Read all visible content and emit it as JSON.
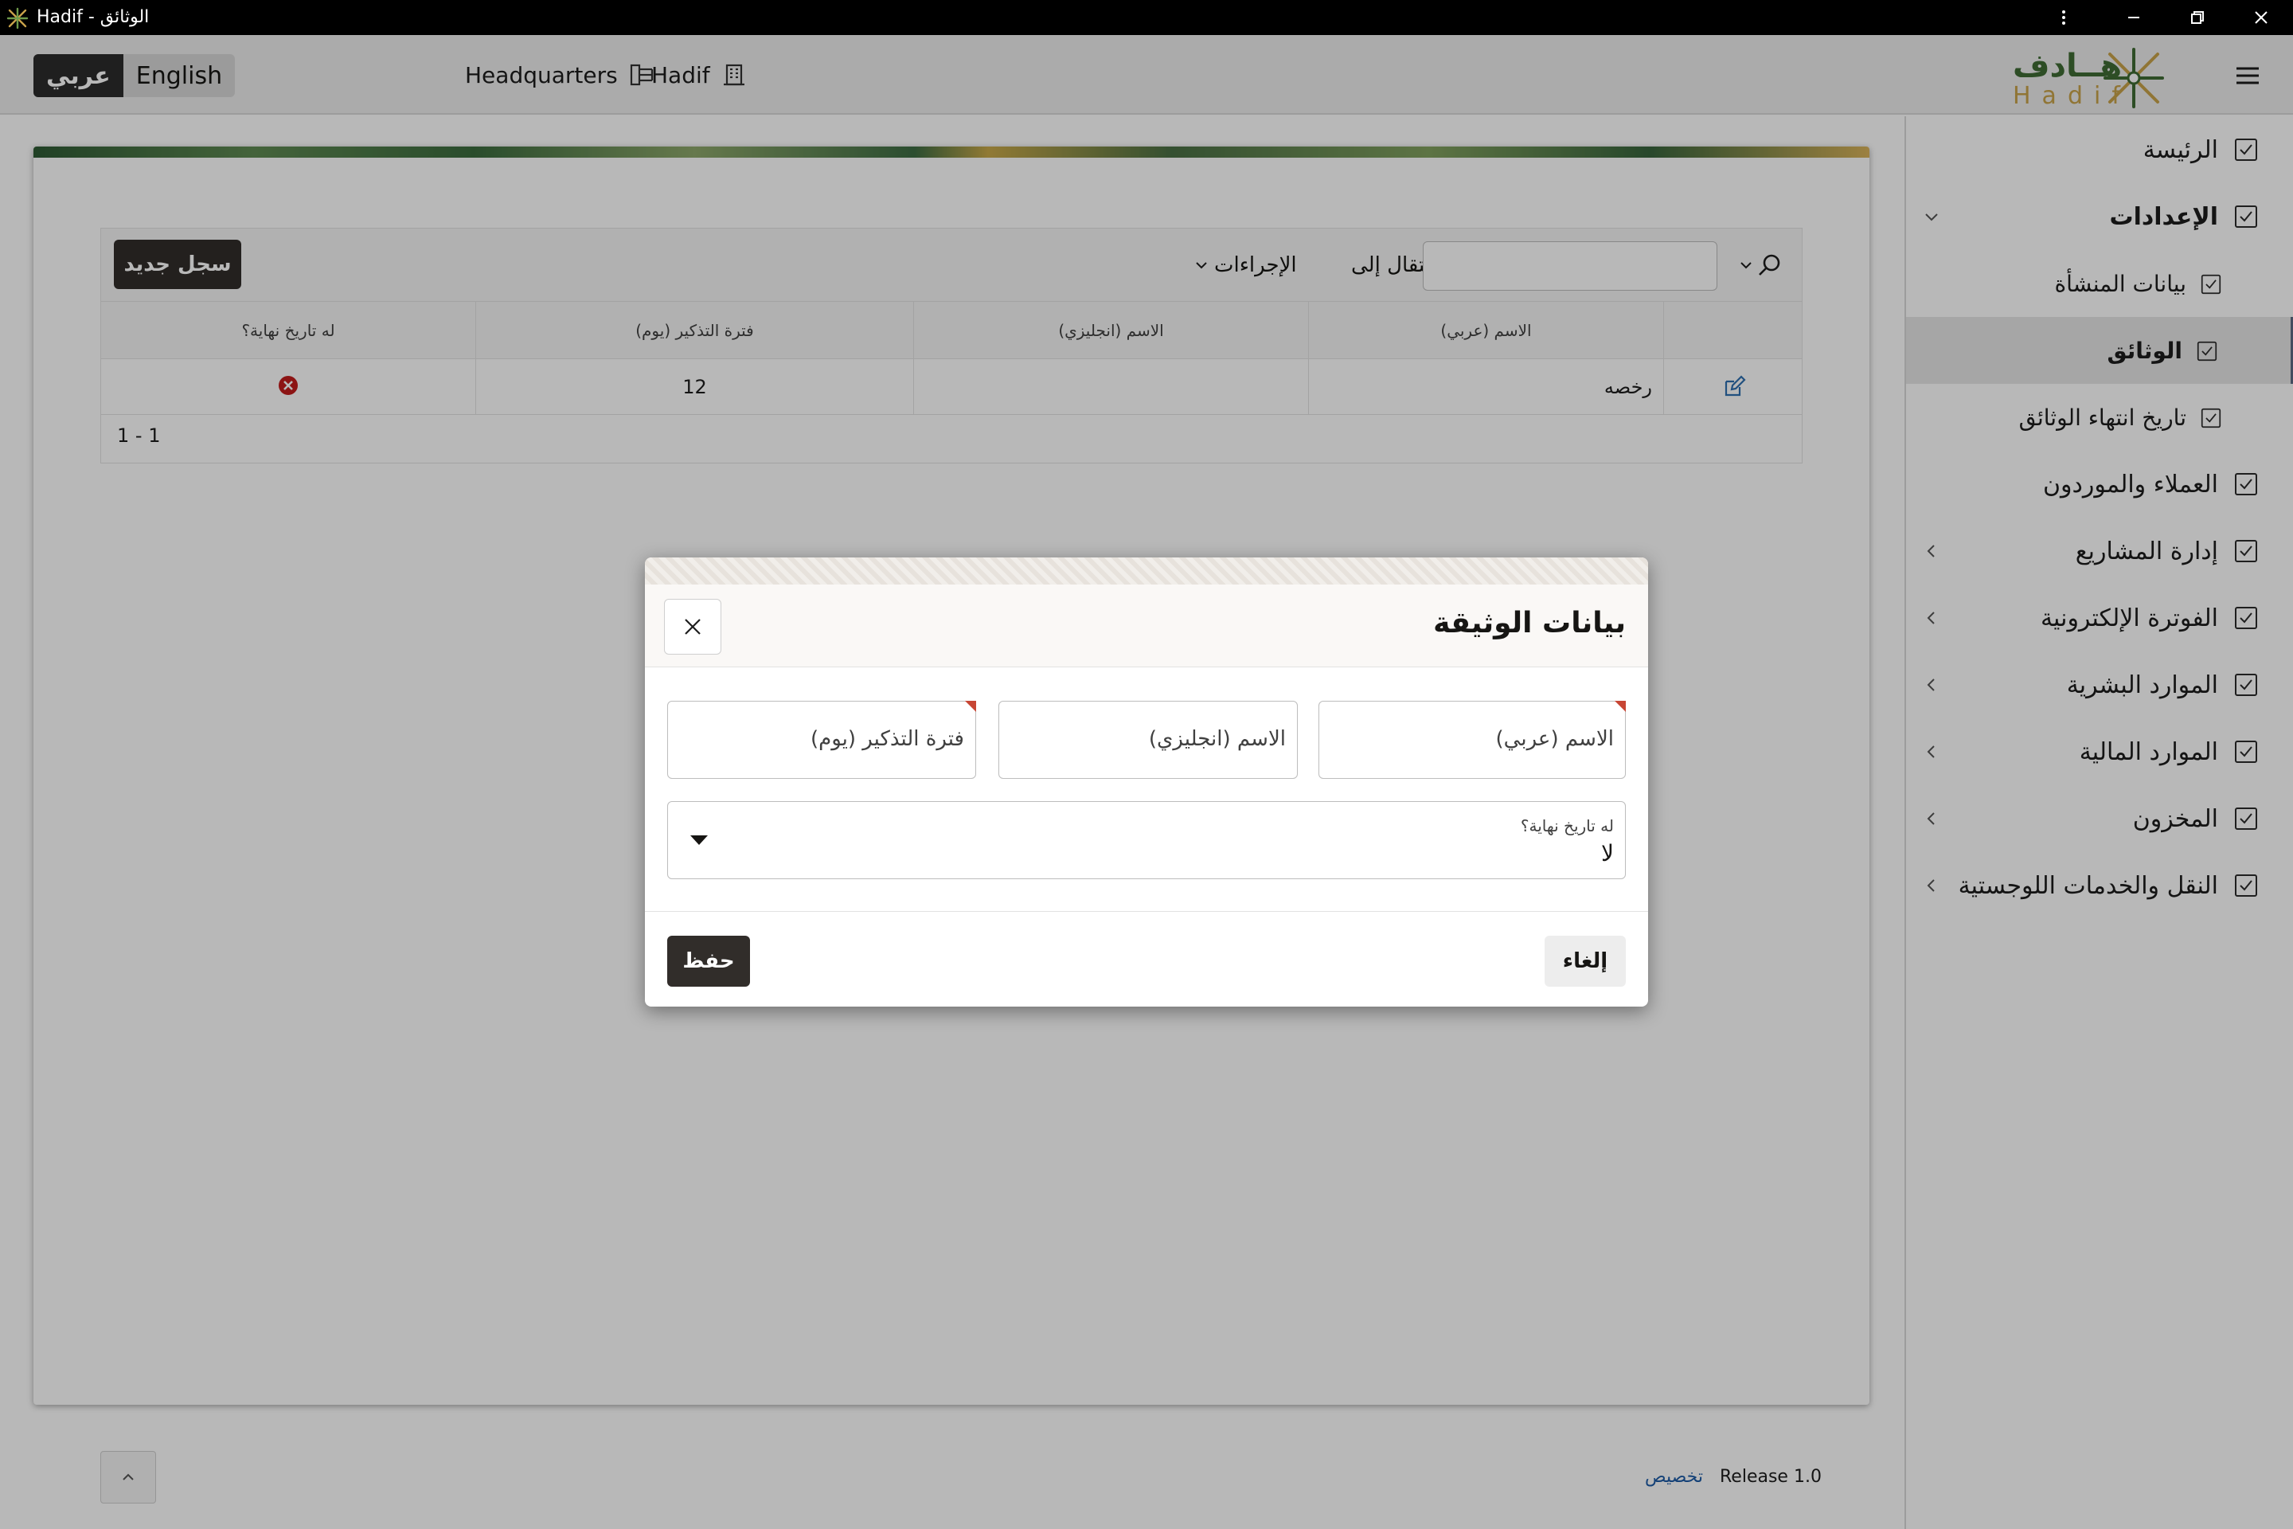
{
  "window": {
    "title": "Hadif - الوثائق",
    "icon": "hadif-logo-icon"
  },
  "header": {
    "lang_arabic": "عربي",
    "lang_english": "English",
    "org_unit": "Headquarters",
    "company": "Hadif",
    "logo_arabic": "هــادف",
    "logo_latin": "Hadif"
  },
  "toolbar": {
    "new_record": "سجل جديد",
    "actions": "الإجراءات",
    "go_to": "انتقال إلى",
    "search_placeholder": ""
  },
  "grid": {
    "columns": [
      "الاسم (عربي)",
      "الاسم (انجليزي)",
      "فترة التذكير (يوم)",
      "له تاريخ نهاية؟"
    ],
    "rows": [
      {
        "name_ar": "رخصه",
        "name_en": "",
        "reminder_days": "12",
        "has_end_date": "no"
      }
    ],
    "pagination": "1 - 1"
  },
  "sidebar": {
    "items": [
      {
        "label": "الرئيسة",
        "level": 0
      },
      {
        "label": "الإعدادات",
        "level": 0,
        "expanded": true
      },
      {
        "label": "بيانات المنشأة",
        "level": 1
      },
      {
        "label": "الوثائق",
        "level": 1,
        "active": true
      },
      {
        "label": "تاريخ انتهاء الوثائق",
        "level": 1
      },
      {
        "label": "العملاء والموردون",
        "level": 0
      },
      {
        "label": "إدارة المشاريع",
        "level": 0,
        "has_children": true
      },
      {
        "label": "الفوترة الإلكترونية",
        "level": 0,
        "has_children": true
      },
      {
        "label": "الموارد البشرية",
        "level": 0,
        "has_children": true
      },
      {
        "label": "الموارد المالية",
        "level": 0,
        "has_children": true
      },
      {
        "label": "المخزون",
        "level": 0,
        "has_children": true
      },
      {
        "label": "النقل والخدمات اللوجستية",
        "level": 0,
        "has_children": true
      }
    ]
  },
  "footer": {
    "release": "Release 1.0",
    "customize": "تخصيص"
  },
  "dialog": {
    "title": "بيانات الوثيقة",
    "name_ar_placeholder": "الاسم (عربي)",
    "name_en_placeholder": "الاسم (انجليزي)",
    "reminder_placeholder": "فترة التذكير (يوم)",
    "has_end_date_label": "له تاريخ نهاية؟",
    "has_end_date_value": "لا",
    "save": "حفظ",
    "cancel": "إلغاء"
  },
  "colors": {
    "primary_button": "#312d2a",
    "required_marker": "#c74634",
    "error_icon": "#c21d1d",
    "link": "#1c5aa6",
    "edit_icon": "#2f6fb0"
  }
}
